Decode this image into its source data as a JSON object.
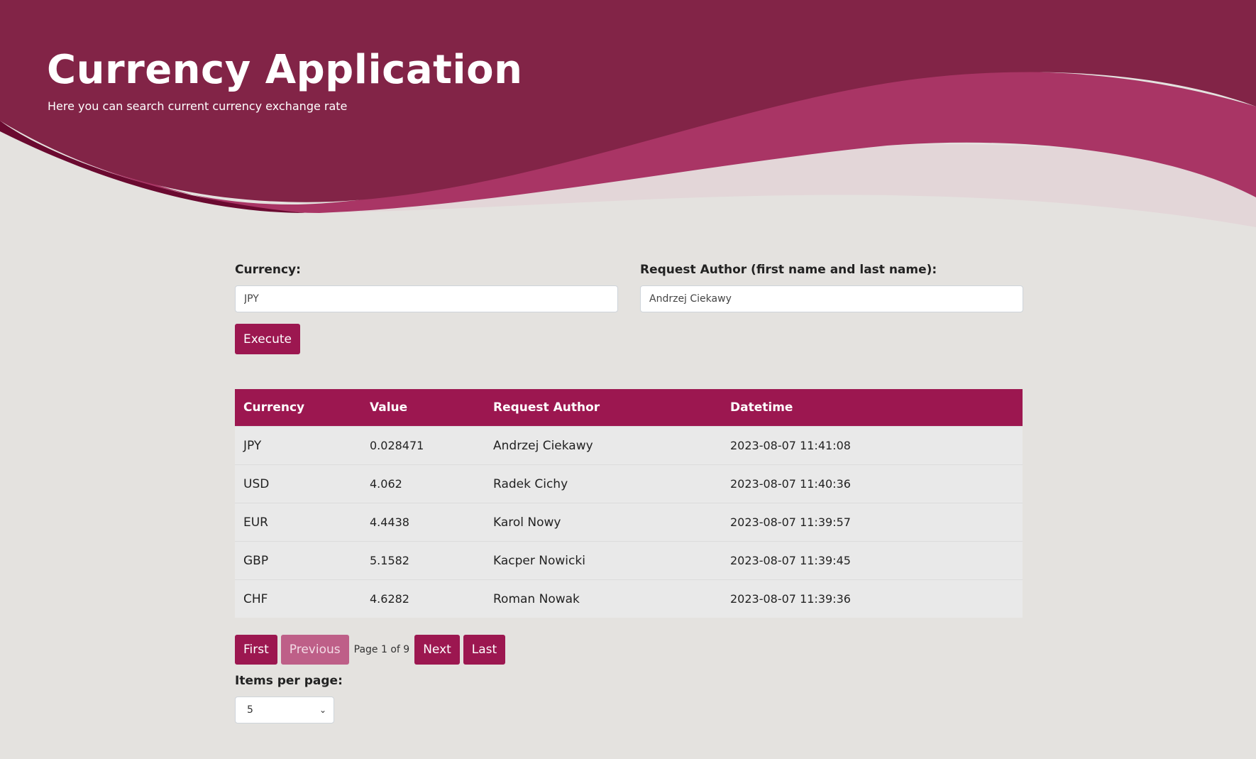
{
  "header": {
    "title": "Currency Application",
    "subtitle": "Here you can search current currency exchange rate"
  },
  "form": {
    "currency_label": "Currency:",
    "currency_value": "JPY",
    "author_label": "Request Author (first name and last name):",
    "author_value": "Andrzej Ciekawy",
    "execute_label": "Execute"
  },
  "table": {
    "headers": [
      "Currency",
      "Value",
      "Request Author",
      "Datetime"
    ],
    "rows": [
      [
        "JPY",
        "0.028471",
        "Andrzej Ciekawy",
        "2023-08-07 11:41:08"
      ],
      [
        "USD",
        "4.062",
        "Radek Cichy",
        "2023-08-07 11:40:36"
      ],
      [
        "EUR",
        "4.4438",
        "Karol Nowy",
        "2023-08-07 11:39:57"
      ],
      [
        "GBP",
        "5.1582",
        "Kacper Nowicki",
        "2023-08-07 11:39:45"
      ],
      [
        "CHF",
        "4.6282",
        "Roman Nowak",
        "2023-08-07 11:39:36"
      ]
    ]
  },
  "pagination": {
    "first": "First",
    "previous": "Previous",
    "page_info": "Page 1 of 9",
    "next": "Next",
    "last": "Last",
    "items_per_page_label": "Items per page:",
    "items_per_page_value": "5"
  },
  "icons": {
    "select_arrow": "chevron-down-icon"
  },
  "colors": {
    "header_dark": "#822447",
    "wave_mid": "#a93565",
    "wave_light": "#e3d6d8",
    "accent": "#9c1750",
    "accent_disabled": "#be5f88",
    "page_bg": "#e4e2df"
  }
}
